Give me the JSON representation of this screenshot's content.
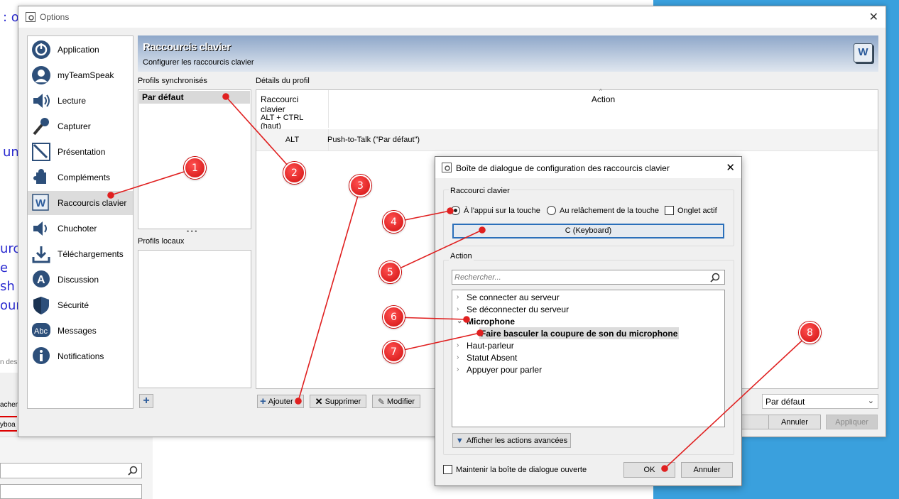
{
  "background": {
    "fragments": [
      ": o",
      "un",
      "urci",
      "e",
      "sh t",
      "our"
    ],
    "small_text": "n des",
    "tab_a": "achem",
    "tab_b": "yboa"
  },
  "options_window": {
    "title": "Options",
    "sidebar": [
      {
        "label": "Application",
        "icon": "power-icon"
      },
      {
        "label": "myTeamSpeak",
        "icon": "user-icon"
      },
      {
        "label": "Lecture",
        "icon": "speaker-icon"
      },
      {
        "label": "Capturer",
        "icon": "microphone-icon"
      },
      {
        "label": "Présentation",
        "icon": "presentation-icon"
      },
      {
        "label": "Compléments",
        "icon": "puzzle-icon"
      },
      {
        "label": "Raccourcis clavier",
        "icon": "keyboard-shortcut-icon",
        "selected": true
      },
      {
        "label": "Chuchoter",
        "icon": "whisper-icon"
      },
      {
        "label": "Téléchargements",
        "icon": "download-icon"
      },
      {
        "label": "Discussion",
        "icon": "chat-icon"
      },
      {
        "label": "Sécurité",
        "icon": "shield-icon"
      },
      {
        "label": "Messages",
        "icon": "abc-icon"
      },
      {
        "label": "Notifications",
        "icon": "info-icon"
      }
    ],
    "header": {
      "title": "Raccourcis clavier",
      "subtitle": "Configurer les raccourcis clavier"
    },
    "synced_profiles_label": "Profils synchronisés",
    "synced_profiles": [
      "Par défaut"
    ],
    "local_profiles_label": "Profils locaux",
    "splitter": "• • •",
    "details_label": "Détails du profil",
    "table": {
      "columns": [
        "Raccourci clavier",
        "Action"
      ],
      "rows": [
        {
          "key": "ALT + CTRL (haut)",
          "action": ""
        },
        {
          "key": "ALT",
          "action": "Push-to-Talk (\"Par défaut\")"
        }
      ]
    },
    "buttons": {
      "add": "Ajouter",
      "delete": "Supprimer",
      "edit": "Modifier",
      "cancel": "Annuler",
      "apply": "Appliquer",
      "plus": "+"
    },
    "profile_select": "Par défaut"
  },
  "dialog": {
    "title": "Boîte de dialogue de configuration des raccourcis clavier",
    "shortcut_group": "Raccourci clavier",
    "radio_press": "À l'appui sur la touche",
    "radio_release": "Au relâchement de la touche",
    "tab_active": "Onglet actif",
    "key_value": "C (Keyboard)",
    "action_group": "Action",
    "search_placeholder": "Rechercher...",
    "tree": [
      {
        "label": "Se connecter au serveur",
        "expanded": false
      },
      {
        "label": "Se déconnecter du serveur",
        "expanded": false
      },
      {
        "label": "Microphone",
        "expanded": true,
        "bold": true
      },
      {
        "label": "Faire basculer la coupure de son du microphone",
        "child": true,
        "selected": true
      },
      {
        "label": "Haut-parleur",
        "expanded": false
      },
      {
        "label": "Statut Absent",
        "expanded": false
      },
      {
        "label": "Appuyer pour parler",
        "expanded": false
      }
    ],
    "advanced": "Afficher les actions avancées",
    "keep_open": "Maintenir la boîte de dialogue ouverte",
    "ok": "OK",
    "cancel": "Annuler"
  },
  "markers": [
    "1",
    "2",
    "3",
    "4",
    "5",
    "6",
    "7",
    "8"
  ],
  "colors": {
    "marker": "#d81b1b",
    "bg_blue": "#3aa0dd",
    "header_top": "#8ea7c9"
  }
}
